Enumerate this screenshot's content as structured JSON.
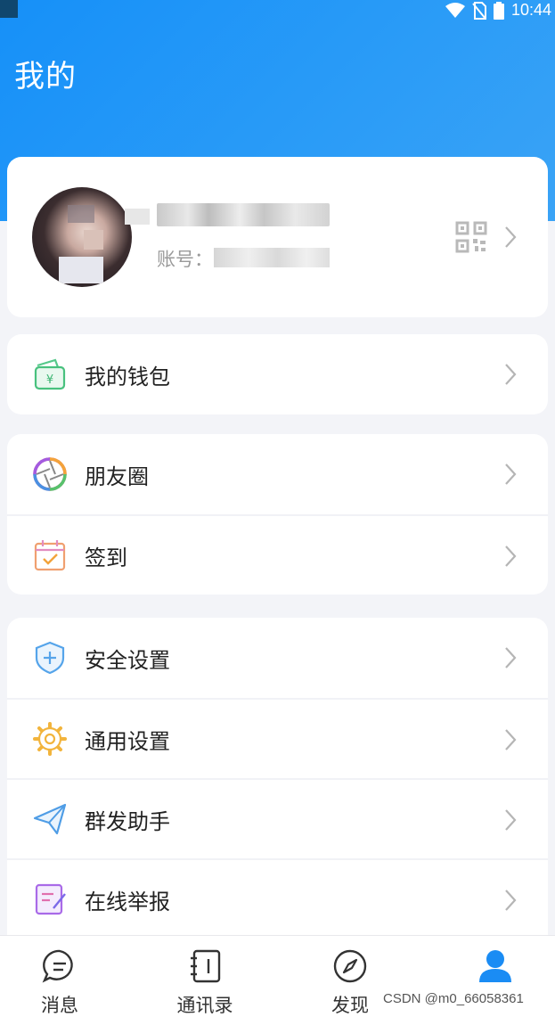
{
  "status_bar": {
    "time": "10:44"
  },
  "header": {
    "title": "我的"
  },
  "profile": {
    "account_label": "账号：",
    "qr_icon": "qr-code-icon",
    "chevron_icon": "chevron-right-icon"
  },
  "menu": {
    "wallet": {
      "label": "我的钱包",
      "icon": "wallet-icon"
    },
    "moments": {
      "label": "朋友圈",
      "icon": "aperture-icon"
    },
    "checkin": {
      "label": "签到",
      "icon": "calendar-check-icon"
    },
    "security": {
      "label": "安全设置",
      "icon": "shield-plus-icon"
    },
    "general": {
      "label": "通用设置",
      "icon": "gear-icon"
    },
    "broadcast": {
      "label": "群发助手",
      "icon": "paper-plane-icon"
    },
    "report": {
      "label": "在线举报",
      "icon": "edit-note-icon"
    }
  },
  "tab_bar": {
    "tabs": [
      {
        "label": "消息",
        "icon": "chat-bubble-icon",
        "active": false
      },
      {
        "label": "通讯录",
        "icon": "contacts-book-icon",
        "active": false
      },
      {
        "label": "发现",
        "icon": "compass-icon",
        "active": false
      },
      {
        "label": "",
        "icon": "person-icon",
        "active": true
      }
    ]
  },
  "watermark": "CSDN @m0_66058361",
  "colors": {
    "accent": "#1a8cf4",
    "header_gradient_start": "#1690f8",
    "header_gradient_end": "#3aa3f6",
    "background": "#f3f4f8"
  }
}
